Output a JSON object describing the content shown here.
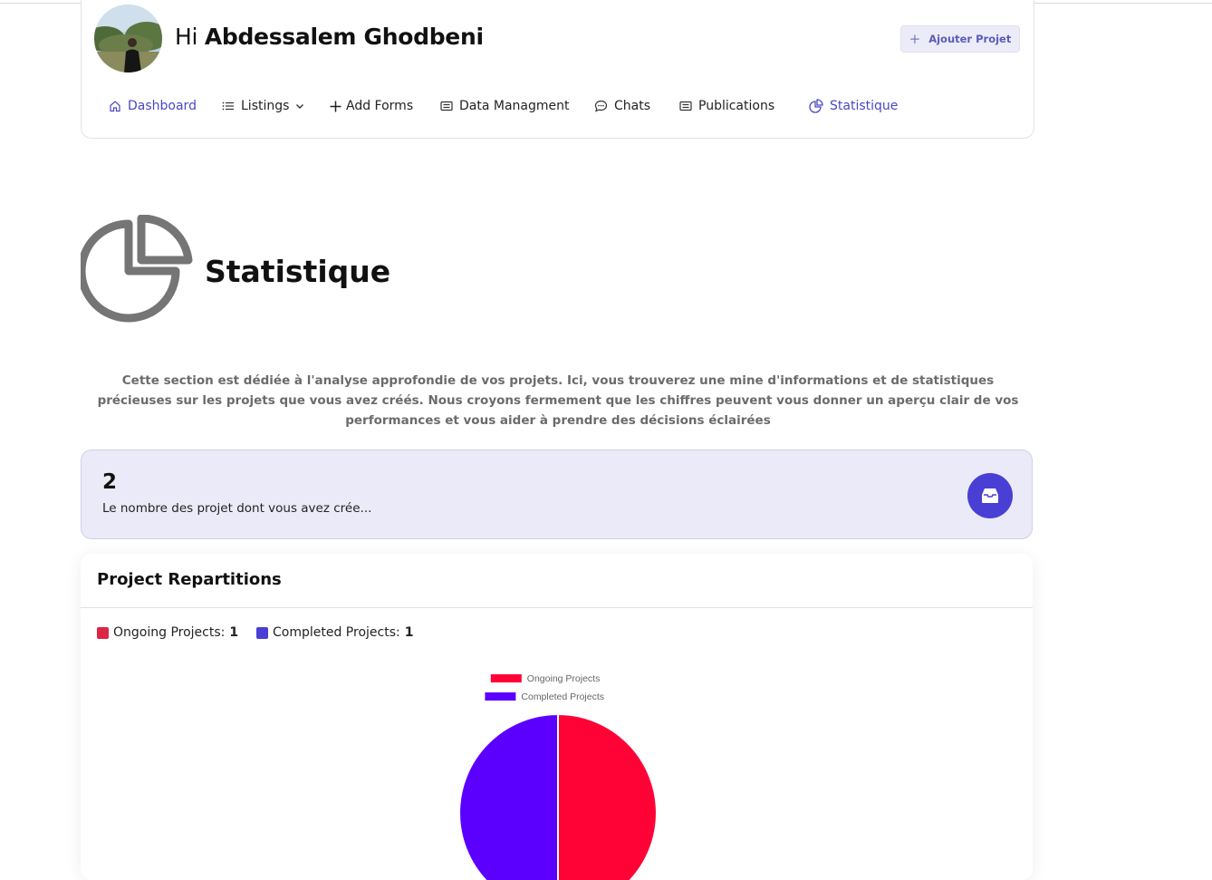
{
  "header": {
    "greeting_hi": "Hi",
    "user_name": "Abdessalem Ghodbeni",
    "add_project_label": "Ajouter Projet"
  },
  "nav": {
    "dashboard": "Dashboard",
    "listings": "Listings",
    "add_forms": "Add Forms",
    "data_management": "Data Managment",
    "chats": "Chats",
    "publications": "Publications",
    "statistique": "Statistique",
    "active": "Statistique"
  },
  "page": {
    "title": "Statistique",
    "description": "Cette section est dédiée à l'analyse approfondie de vos projets. Ici, vous trouverez une mine d'informations et de statistiques précieuses sur les projets que vous avez créés. Nous croyons fermement que les chiffres peuvent vous donner un aperçu clair de vos performances et vous aider à prendre des décisions éclairées"
  },
  "count_card": {
    "value": "2",
    "label": "Le nombre des projet dont vous avez crée..."
  },
  "chart_card": {
    "title": "Project Repartitions",
    "summary": [
      {
        "label": "Ongoing Projects:",
        "value": "1",
        "color": "#dc2645"
      },
      {
        "label": "Completed Projects:",
        "value": "1",
        "color": "#4a3fd4"
      }
    ]
  },
  "colors": {
    "accent": "#4a3fd4",
    "nav_active": "#4a47c4",
    "count_card_bg": "#ebeaf8"
  },
  "chart_data": {
    "type": "pie",
    "categories": [
      "Ongoing Projects",
      "Completed Projects"
    ],
    "values": [
      1,
      1
    ],
    "colors": [
      "#ff0337",
      "#5b00ff"
    ],
    "legend_position": "top"
  }
}
